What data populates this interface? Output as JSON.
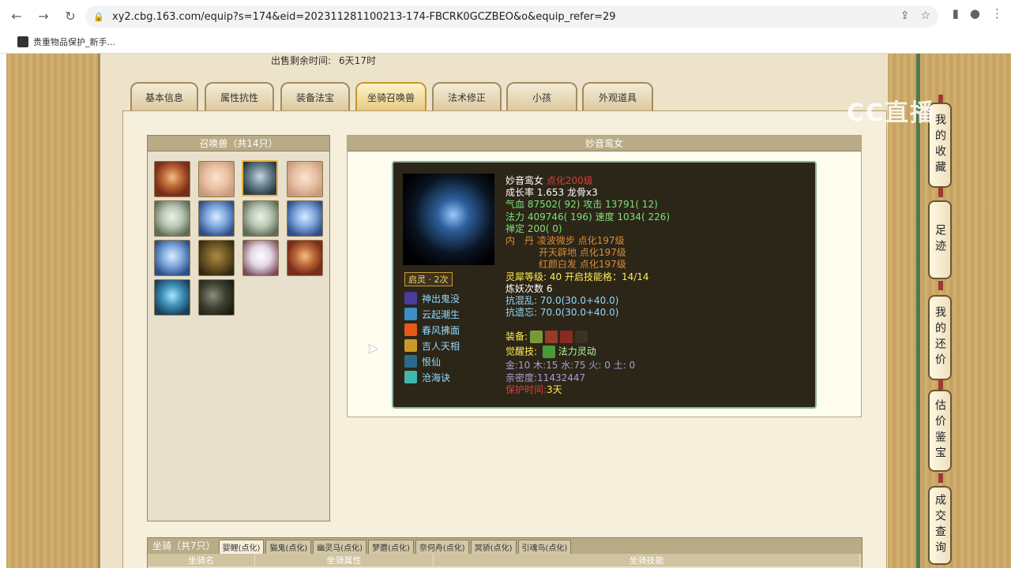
{
  "browser": {
    "url": "xy2.cbg.163.com/equip?s=174&eid=202311281100213-174-FBCRK0GCZBEO&o&equip_refer=29",
    "bookmark": "贵重物品保护_新手..."
  },
  "sale": {
    "label": "出售剩余时间:",
    "value": "6天17时"
  },
  "tabs": [
    "基本信息",
    "属性抗性",
    "装备法宝",
    "坐骑召唤兽",
    "法术修正",
    "小孩",
    "外观道具"
  ],
  "active_tab": "坐骑召唤兽",
  "list_panel": {
    "title": "召唤兽（共14只）"
  },
  "detail": {
    "title": "妙音鸾女",
    "name": "妙音鸾女",
    "name_tag": "点化200级",
    "growth": "成长率 1.653 龙骨x3",
    "hp_label": "气血",
    "hp": "87502( 92)",
    "atk_label": "攻击",
    "atk": "13791( 12)",
    "mp_label": "法力",
    "mp": "409746( 196)",
    "spd_label": "速度",
    "spd": "1034( 226)",
    "focus_label": "禅定",
    "focus": "200( 0)",
    "dan_label": "内　丹",
    "dan": [
      "凌波微步 点化197级",
      "开天辟地 点化197级",
      "红颜白发 点化197级"
    ],
    "spirit_label": "灵犀等级:",
    "spirit": "40 开启技能格：14/14",
    "refine": "炼妖次数 6",
    "resist1_label": "抗混乱:",
    "resist1": "70.0(30.0+40.0)",
    "resist2_label": "抗遗忘:",
    "resist2": "70.0(30.0+40.0)",
    "equip_label": "装备:",
    "awake_label": "觉醒技:",
    "awake": "法力灵动",
    "elements": "金:10 木:15 水:75 火: 0 土: 0",
    "intimacy": "亲密度:11432447",
    "protect_label": "保护时间:",
    "protect": "3天",
    "qiling": "启灵 · 2次",
    "skills": [
      "神出鬼没",
      "云起潮生",
      "春风拂面",
      "吉人天相",
      "恨仙",
      "沧海诀"
    ]
  },
  "mount": {
    "title": "坐骑（共7只）",
    "tabs": [
      "婴鲤(点化)",
      "猫鬼(点化)",
      "幽灵马(点化)",
      "梦蘑(点化)",
      "奈何舟(点化)",
      "冥骄(点化)",
      "引魂鸟(点化)"
    ],
    "cols": [
      "坐骑名",
      "坐骑属性",
      "坐骑技能"
    ]
  },
  "watermark": "CC直播",
  "side_nav": [
    "我的收藏",
    "足迹",
    "我的还价",
    "估价鉴宝",
    "成交查询"
  ]
}
